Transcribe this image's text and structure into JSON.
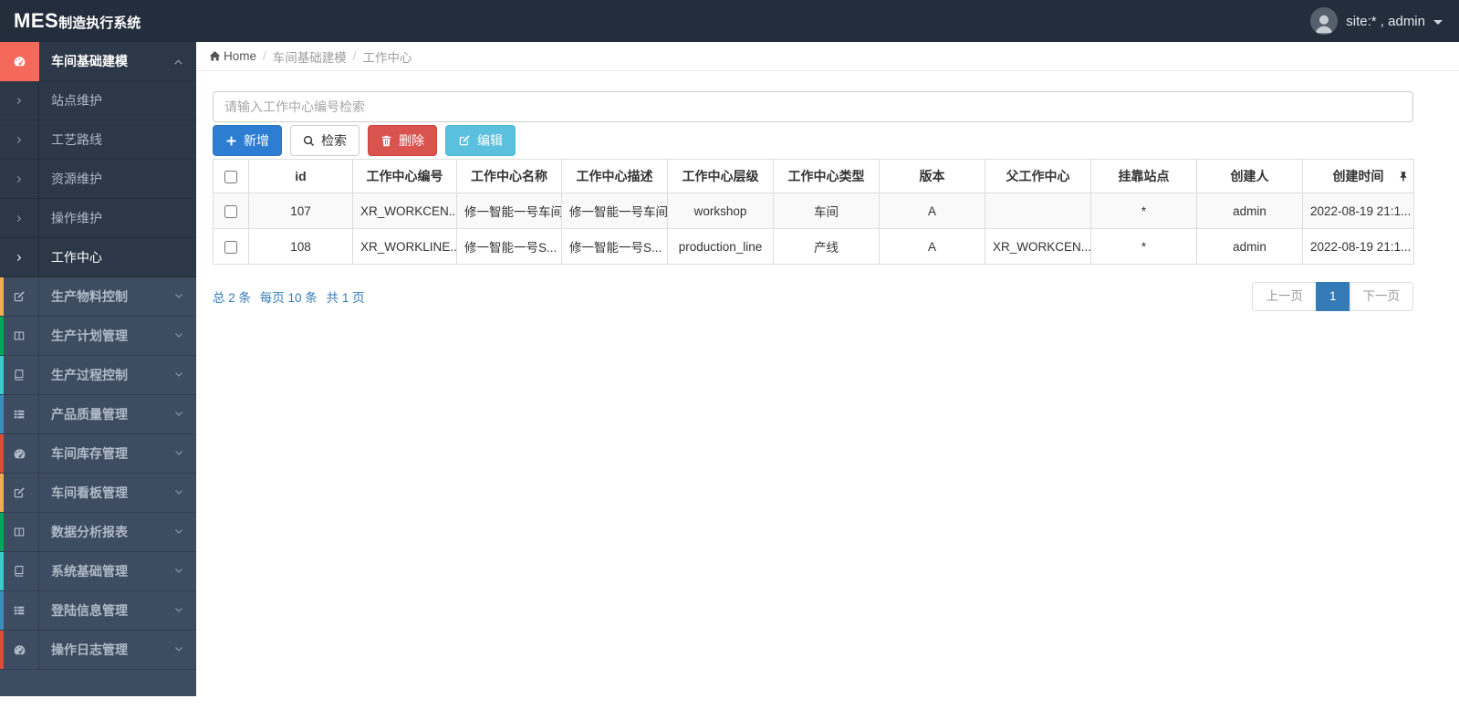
{
  "navbar": {
    "logo_bold": "MES",
    "logo_rest": "制造执行系统",
    "user_label": "site:* , admin"
  },
  "breadcrumb": {
    "items": [
      "Home",
      "车间基础建模",
      "工作中心"
    ]
  },
  "sidebar": {
    "active_group": {
      "label": "车间基础建模",
      "icon": "dashboard-icon"
    },
    "sub_items": [
      {
        "label": "站点维护",
        "active": false
      },
      {
        "label": "工艺路线",
        "active": false
      },
      {
        "label": "资源维护",
        "active": false
      },
      {
        "label": "操作维护",
        "active": false
      },
      {
        "label": "工作中心",
        "active": true
      }
    ],
    "groups": [
      {
        "label": "生产物料控制",
        "icon": "edit-icon",
        "accent": "#f0ad4e"
      },
      {
        "label": "生产计划管理",
        "icon": "columns-icon",
        "accent": "#00a65a"
      },
      {
        "label": "生产过程控制",
        "icon": "book-icon",
        "accent": "#39cccc"
      },
      {
        "label": "产品质量管理",
        "icon": "list-icon",
        "accent": "#3c8dbc"
      },
      {
        "label": "车间库存管理",
        "icon": "dashboard-icon",
        "accent": "#dd4b39"
      },
      {
        "label": "车间看板管理",
        "icon": "edit-icon",
        "accent": "#f0ad4e"
      },
      {
        "label": "数据分析报表",
        "icon": "columns-icon",
        "accent": "#00a65a"
      },
      {
        "label": "系统基础管理",
        "icon": "book-icon",
        "accent": "#39cccc"
      },
      {
        "label": "登陆信息管理",
        "icon": "list-icon",
        "accent": "#3c8dbc"
      },
      {
        "label": "操作日志管理",
        "icon": "dashboard-icon",
        "accent": "#dd4b39"
      }
    ]
  },
  "toolbar": {
    "search_placeholder": "请输入工作中心编号检索",
    "add_label": "新增",
    "search_label": "检索",
    "delete_label": "删除",
    "edit_label": "编辑"
  },
  "table": {
    "headers": [
      "id",
      "工作中心编号",
      "工作中心名称",
      "工作中心描述",
      "工作中心层级",
      "工作中心类型",
      "版本",
      "父工作中心",
      "挂靠站点",
      "创建人",
      "创建时间"
    ],
    "rows": [
      [
        "107",
        "XR_WORKCEN...",
        "修一智能一号车间",
        "修一智能一号车间",
        "workshop",
        "车间",
        "A",
        "",
        "*",
        "admin",
        "2022-08-19 21:1..."
      ],
      [
        "108",
        "XR_WORKLINE...",
        "修一智能一号S...",
        "修一智能一号S...",
        "production_line",
        "产线",
        "A",
        "XR_WORKCEN...",
        "*",
        "admin",
        "2022-08-19 21:1..."
      ]
    ]
  },
  "pagination": {
    "summary_total": "总 2 条",
    "summary_per": "每页 10 条",
    "summary_pages": "共 1 页",
    "prev_label": "上一页",
    "current_page": "1",
    "next_label": "下一页"
  },
  "colors": {
    "navbar_bg": "#232d3b",
    "sidebar_bg": "#3e4c61",
    "submenu_bg": "#2c3847",
    "active_icon_red": "#f5695b",
    "primary_button": "#2d7dd2",
    "danger_button": "#d9534f",
    "info_button": "#5bc0de",
    "link_blue": "#337ab7"
  }
}
